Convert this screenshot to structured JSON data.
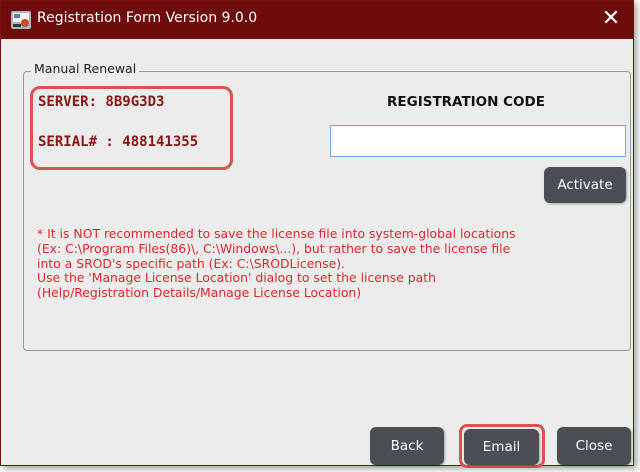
{
  "window": {
    "title": "Registration Form Version 9.0.0",
    "close_glyph": "✕"
  },
  "manual_renewal": {
    "legend": "Manual Renewal",
    "server": "SERVER: 8B9G3D3",
    "serial": "SERIAL# : 488141355",
    "registration_code_title": "REGISTRATION CODE",
    "registration_code_value": "",
    "activate_label": "Activate",
    "notice_lines": [
      "* It is NOT recommended to save the license file into system-global locations",
      "(Ex: C:\\Program Files(86)\\, C:\\Windows\\...), but rather to save the license file",
      "into a SROD's specific path (Ex: C:\\SRODLicense).",
      "Use the 'Manage License Location' dialog to set the license path",
      "(Help/Registration Details/Manage License Location)"
    ]
  },
  "footer": {
    "back_label": "Back",
    "email_label": "Email",
    "close_label": "Close"
  },
  "colors": {
    "title_bar": "#6e0b0b",
    "server_text": "#8b1414",
    "notice_text": "#e2262b",
    "highlight": "#d9534f",
    "button": "#4a4f55"
  }
}
